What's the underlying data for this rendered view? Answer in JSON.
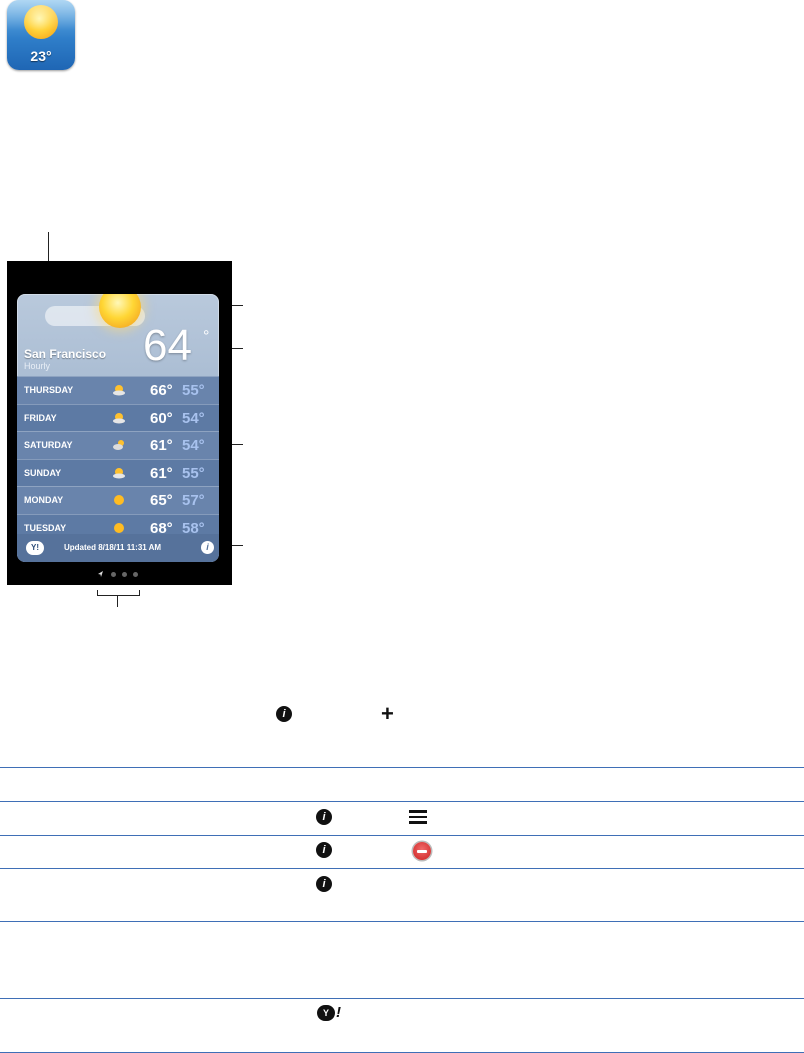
{
  "app_icon": {
    "temperature": "23°"
  },
  "weather_card": {
    "city": "San Francisco",
    "subtitle": "Hourly",
    "current_temp": "64",
    "degree_symbol": "°",
    "forecast": [
      {
        "day": "THURSDAY",
        "icon": "sun-cloud-icon",
        "high": "66°",
        "low": "55°"
      },
      {
        "day": "FRIDAY",
        "icon": "sun-cloud-icon",
        "high": "60°",
        "low": "54°"
      },
      {
        "day": "SATURDAY",
        "icon": "cloud-sun-icon",
        "high": "61°",
        "low": "54°"
      },
      {
        "day": "SUNDAY",
        "icon": "sun-cloud-icon",
        "high": "61°",
        "low": "55°"
      },
      {
        "day": "MONDAY",
        "icon": "sun-icon",
        "high": "65°",
        "low": "57°"
      },
      {
        "day": "TUESDAY",
        "icon": "sun-icon",
        "high": "68°",
        "low": "58°"
      }
    ],
    "yahoo_badge": "Y!",
    "updated": "Updated 8/18/11   11:31 AM",
    "info_glyph": "i"
  },
  "page_indicator": {
    "count": 4,
    "first_is_location_arrow": true
  },
  "lower_icons": {
    "info_glyph": "i",
    "plus_glyph": "+",
    "yahoo_ball": "Y",
    "yahoo_bang": "!"
  },
  "colors": {
    "rule": "#3f6fb6",
    "row_a": "#6984ac",
    "row_b": "#5d7aa4",
    "low_temp": "#a8c2ee"
  }
}
